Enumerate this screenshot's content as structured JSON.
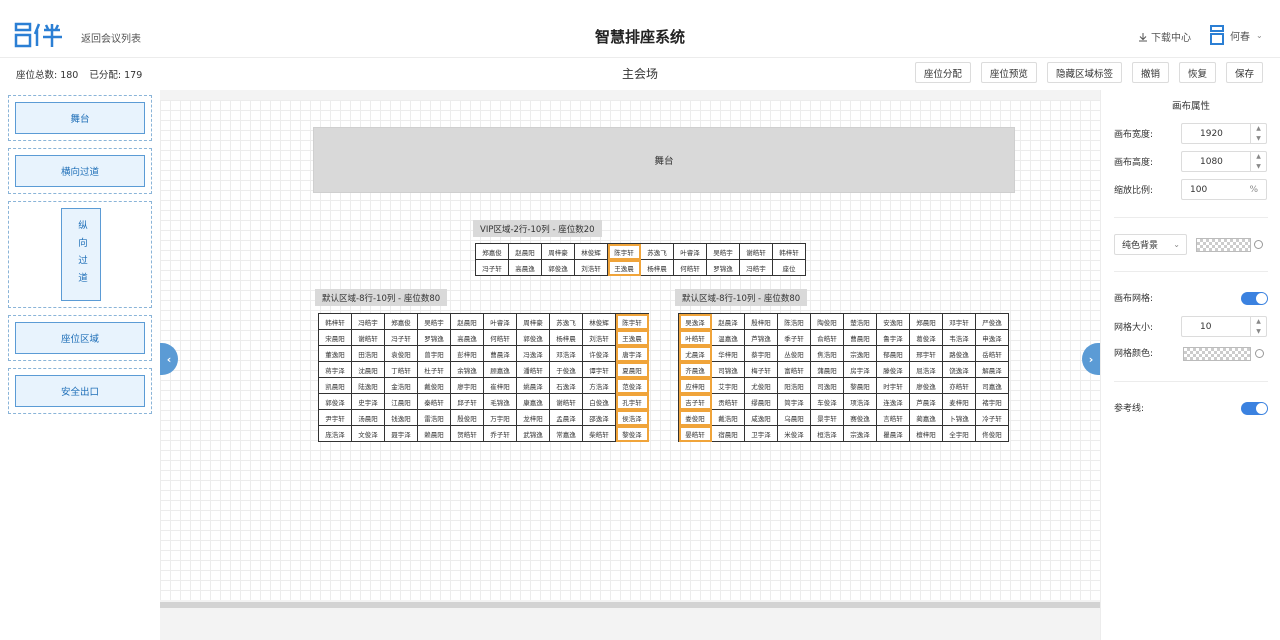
{
  "header": {
    "back_label": "返回会议列表",
    "app_title": "智慧排座系统",
    "download_label": "下载中心",
    "user_name": "何春"
  },
  "toolbar": {
    "total_seats_label": "座位总数: 180",
    "assigned_label": "已分配: 179",
    "venue_name": "主会场",
    "buttons": [
      "座位分配",
      "座位预览",
      "隐藏区域标签",
      "撤销",
      "恢复",
      "保存"
    ]
  },
  "components": [
    "舞台",
    "横向过道",
    "纵向过道",
    "座位区域",
    "安全出口"
  ],
  "canvas": {
    "stage_label": "舞台",
    "vip_label": "VIP区域-2行-10列 - 座位数20",
    "left_label": "默认区域-8行-10列 - 座位数80",
    "right_label": "默认区域-8行-10列 - 座位数80",
    "vip_rows": [
      [
        "郑嘉俊",
        "赵晨阳",
        "周梓豪",
        "林俊辉",
        "陈宇轩",
        "苏逸飞",
        "叶睿泽",
        "吴皓宇",
        "谢皓轩",
        "韩梓轩"
      ],
      [
        "冯子轩",
        "高晨逸",
        "郭俊逸",
        "刘浩轩",
        "王逸晨",
        "杨梓晨",
        "何皓轩",
        "罗锦逸",
        "冯皓宇",
        "座位"
      ]
    ],
    "left_rows": [
      [
        "韩梓轩",
        "冯皓宇",
        "郑嘉俊",
        "吴皓宇",
        "赵晨阳",
        "叶睿泽",
        "周梓豪",
        "苏逸飞",
        "林俊辉",
        "陈宇轩"
      ],
      [
        "宋晨阳",
        "谢皓轩",
        "冯子轩",
        "罗锦逸",
        "高晨逸",
        "何皓轩",
        "郭俊逸",
        "杨梓晨",
        "刘浩轩",
        "王逸晨"
      ],
      [
        "董逸阳",
        "田浩阳",
        "袁俊阳",
        "曾宇阳",
        "彭梓阳",
        "曹晨泽",
        "冯逸泽",
        "邓浩泽",
        "许俊泽",
        "唐宇泽"
      ],
      [
        "蒋宇泽",
        "沈晨阳",
        "丁皓轩",
        "杜子轩",
        "余锦逸",
        "顾嘉逸",
        "潘皓轩",
        "于俊逸",
        "谭宇轩",
        "夏晨阳"
      ],
      [
        "凯晨阳",
        "陆逸阳",
        "金浩阳",
        "戴俊阳",
        "廖宇阳",
        "崔梓阳",
        "姚晨泽",
        "石逸泽",
        "方浩泽",
        "范俊泽"
      ],
      [
        "郭俊泽",
        "史宇泽",
        "江晨阳",
        "秦皓轩",
        "邱子轩",
        "毛锦逸",
        "康嘉逸",
        "谢皓轩",
        "白俊逸",
        "孔宇轩"
      ],
      [
        "尹宇轩",
        "汤晨阳",
        "钱逸阳",
        "雷浩阳",
        "殷俊阳",
        "万宇阳",
        "龙梓阳",
        "孟晨泽",
        "邵逸泽",
        "侯浩泽"
      ],
      [
        "庞浩泽",
        "文俊泽",
        "聂宇泽",
        "赖晨阳",
        "贺皓轩",
        "乔子轩",
        "武锦逸",
        "常嘉逸",
        "柴皓轩",
        "黎俊泽"
      ]
    ],
    "right_rows": [
      [
        "吴逸泽",
        "赵晨泽",
        "殷梓阳",
        "陈浩阳",
        "陶俊阳",
        "楚浩阳",
        "安逸阳",
        "郑晨阳",
        "邓宇轩",
        "严俊逸"
      ],
      [
        "叶皓轩",
        "温嘉逸",
        "芦锦逸",
        "季子轩",
        "俞皓轩",
        "曹晨阳",
        "鲁宇泽",
        "葛俊泽",
        "韦浩泽",
        "申逸泽"
      ],
      [
        "尤晨泽",
        "华梓阳",
        "蔡宇阳",
        "丛俊阳",
        "焦浩阳",
        "宗逸阳",
        "郁晨阳",
        "邢宇轩",
        "路俊逸",
        "岳皓轩"
      ],
      [
        "齐晨逸",
        "司锦逸",
        "梅子轩",
        "富皓轩",
        "蒲晨阳",
        "房宇泽",
        "滕俊泽",
        "屈浩泽",
        "饶逸泽",
        "解晨泽"
      ],
      [
        "应梓阳",
        "艾宇阳",
        "尤俊阳",
        "阳浩阳",
        "司逸阳",
        "黎晨阳",
        "时宇轩",
        "廖俊逸",
        "亦皓轩",
        "司嘉逸"
      ],
      [
        "吉子轩",
        "贡皓轩",
        "缪晨阳",
        "简宇泽",
        "车俊泽",
        "项浩泽",
        "连逸泽",
        "芦晨泽",
        "麦梓阳",
        "褚宇阳"
      ],
      [
        "娄俊阳",
        "戴浩阳",
        "咸逸阳",
        "乌晨阳",
        "景宇轩",
        "赛俊逸",
        "言皓轩",
        "蔺嘉逸",
        "卜锦逸",
        "冷子轩"
      ],
      [
        "晏皓轩",
        "宿晨阳",
        "卫宇泽",
        "米俊泽",
        "桓浩泽",
        "宗逸泽",
        "瞿晨泽",
        "檀梓阳",
        "全宇阳",
        "佟俊阳"
      ]
    ]
  },
  "properties": {
    "title": "画布属性",
    "width_label": "画布宽度:",
    "width_value": "1920",
    "height_label": "画布高度:",
    "height_value": "1080",
    "zoom_label": "缩放比例:",
    "zoom_value": "100",
    "zoom_unit": "%",
    "background_select": "纯色背景",
    "grid_label": "画布网格:",
    "grid_size_label": "网格大小:",
    "grid_size_value": "10",
    "grid_color_label": "网格颜色:",
    "guide_label": "参考线:",
    "grid_on": true,
    "guide_on": true
  },
  "colors": {
    "accent": "#3b82e0",
    "seat_highlight": "#f0a43a",
    "logo": "#2b7fd4"
  },
  "icons": [
    "logo-icon",
    "download-icon",
    "user-icon",
    "chevron-down-icon",
    "chevron-left-icon",
    "chevron-right-icon",
    "color-picker-icon"
  ]
}
